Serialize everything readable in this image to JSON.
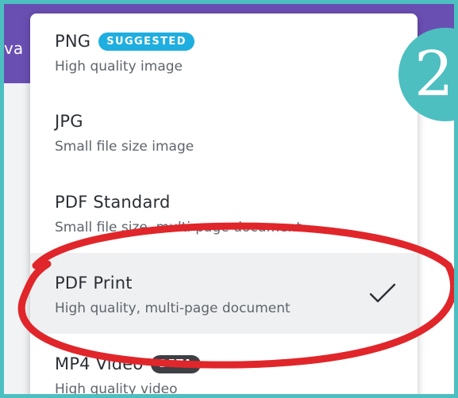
{
  "background": {
    "header_text": "va"
  },
  "step": {
    "number": "2",
    "color": "#4dbfc0"
  },
  "highlight_color": "#e0262a",
  "menu": {
    "items": [
      {
        "title": "PNG",
        "badge": "SUGGESTED",
        "description": "High quality image",
        "selected": false
      },
      {
        "title": "JPG",
        "badge": "",
        "description": "Small file size image",
        "selected": false
      },
      {
        "title": "PDF Standard",
        "badge": "",
        "description": "Small file size, multi-page document",
        "selected": false
      },
      {
        "title": "PDF Print",
        "badge": "",
        "description": "High quality, multi-page document",
        "selected": true,
        "check_icon": "checkmark-icon"
      },
      {
        "title": "MP4 Video",
        "badge": "BETA",
        "description": "High quality video",
        "selected": false
      }
    ]
  }
}
